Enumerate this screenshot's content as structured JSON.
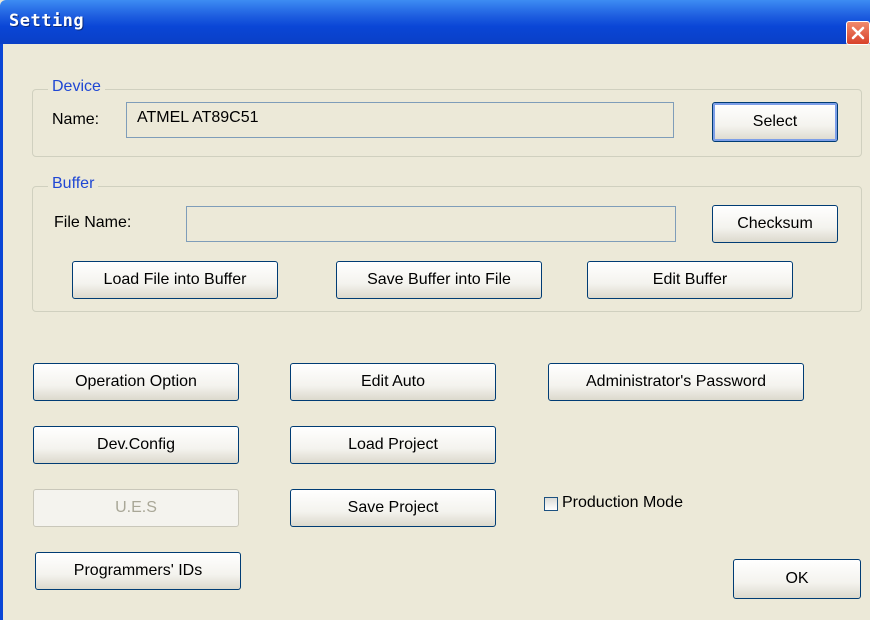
{
  "window": {
    "title": "Setting"
  },
  "device": {
    "legend": "Device",
    "name_label": "Name:",
    "name_value": "ATMEL AT89C51",
    "select_label": "Select"
  },
  "buffer": {
    "legend": "Buffer",
    "file_name_label": "File Name:",
    "file_name_value": "",
    "checksum_label": "Checksum",
    "load_label": "Load File into Buffer",
    "save_label": "Save Buffer into File",
    "edit_label": "Edit Buffer"
  },
  "actions": {
    "operation_option": "Operation Option",
    "edit_auto": "Edit Auto",
    "admin_password": "Administrator's Password",
    "dev_config": "Dev.Config",
    "load_project": "Load Project",
    "ues": "U.E.S",
    "save_project": "Save Project",
    "production_mode": "Production Mode",
    "programmers_ids": "Programmers' IDs",
    "ok": "OK"
  },
  "state": {
    "production_mode_checked": false
  }
}
